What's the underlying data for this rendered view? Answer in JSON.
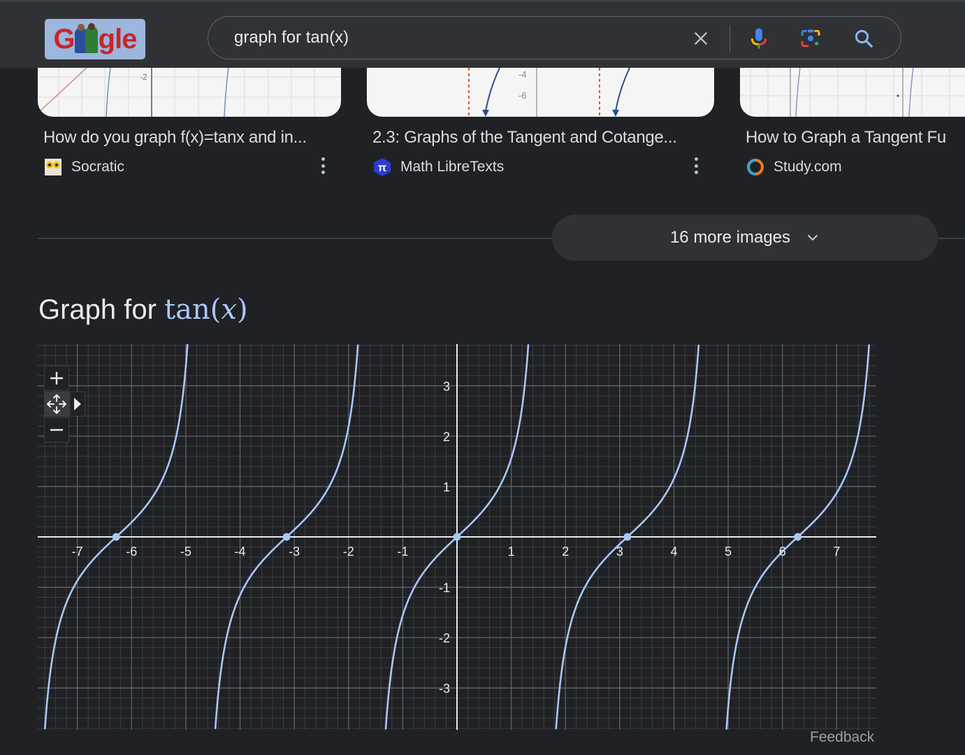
{
  "header": {
    "logo_alt": "Google",
    "logo_letters_left": "G",
    "logo_letters_right": "gle",
    "search": {
      "value": "graph for tan(x)",
      "placeholder": ""
    },
    "icons": [
      "clear-icon",
      "mic-icon",
      "google-lens-icon",
      "search-icon"
    ]
  },
  "image_results": [
    {
      "title": "How do you graph f(x)=tanx and in...",
      "source": "Socratic",
      "favicon": "owl-icon"
    },
    {
      "title": "2.3: Graphs of the Tangent and Cotange...",
      "source": "Math LibreTexts",
      "favicon": "pi-icon"
    },
    {
      "title": "How to Graph a Tangent Fu",
      "source": "Study.com",
      "favicon": "study-ring-icon"
    }
  ],
  "more_images": {
    "label": "16 more images"
  },
  "graph_section": {
    "title_prefix": "Graph for",
    "title_fn": "tan(",
    "title_var": "x",
    "title_close": ")",
    "controls": {
      "zoom_in": "+",
      "zoom_out": "−"
    },
    "feedback": "Feedback"
  },
  "colors": {
    "background": "#202124",
    "header": "#303134",
    "curve": "#a8c7fa",
    "axis": "#e8eaed",
    "grid_major": "#5f6368",
    "grid_minor": "#3c4043"
  },
  "chart_data": {
    "type": "line",
    "title": "Graph for tan(x)",
    "function": "tan(x)",
    "xlabel": "",
    "ylabel": "",
    "xlim": [
      -7.73,
      7.73
    ],
    "ylim": [
      -3.83,
      3.83
    ],
    "x_ticks": [
      -7,
      -6,
      -5,
      -4,
      -3,
      -2,
      -1,
      1,
      2,
      3,
      4,
      5,
      6,
      7
    ],
    "x_tick_labels": [
      "-7",
      "-6",
      "-5",
      "-4",
      "-3",
      "-2",
      "-1",
      "1",
      "2",
      "3",
      "4",
      "5",
      "6",
      "7"
    ],
    "y_ticks": [
      3,
      2,
      1,
      -1,
      -2,
      -3
    ],
    "y_tick_labels": [
      "3",
      "2",
      "1",
      "-1",
      "-2",
      "-3"
    ],
    "grid": true,
    "minor_grid_per_unit": 5,
    "highlighted_points": [
      {
        "x": -6.2832,
        "y": 0
      },
      {
        "x": -3.1416,
        "y": 0
      },
      {
        "x": 0,
        "y": 0
      },
      {
        "x": 3.1416,
        "y": 0
      },
      {
        "x": 6.2832,
        "y": 0
      }
    ],
    "asymptotes": [
      -7.854,
      -4.712,
      -1.571,
      1.571,
      4.712,
      7.854
    ],
    "legend": "none"
  }
}
